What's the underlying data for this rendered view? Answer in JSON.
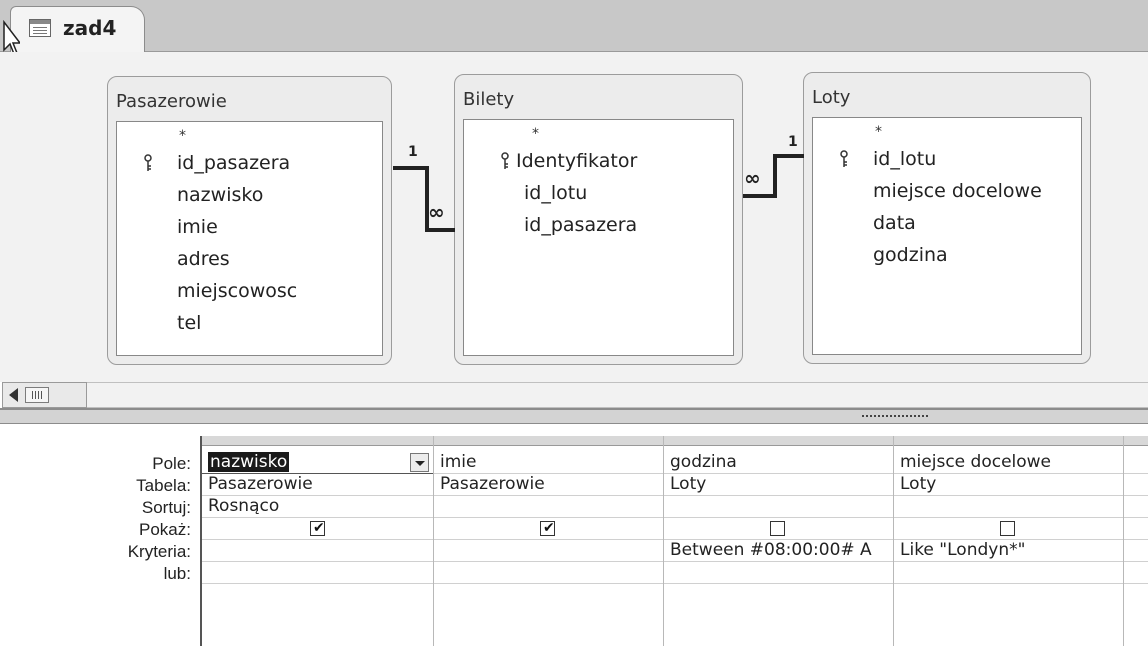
{
  "tab": {
    "title": "zad4"
  },
  "tables": [
    {
      "name": "Pasazerowie",
      "fields": [
        "*",
        "id_pasazera",
        "nazwisko",
        "imie",
        "adres",
        "miejscowosc",
        "tel"
      ]
    },
    {
      "name": "Bilety",
      "fields": [
        "*",
        "Identyfikator",
        "id_lotu",
        "id_pasazera"
      ]
    },
    {
      "name": "Loty",
      "fields": [
        "*",
        "id_lotu",
        "miejsce docelowe",
        "data",
        "godzina"
      ]
    }
  ],
  "relations": [
    {
      "one": "1",
      "many": "∞"
    },
    {
      "one": "1",
      "many": "∞"
    }
  ],
  "grid": {
    "row_labels": [
      "Pole:",
      "Tabela:",
      "Sortuj:",
      "Pokaż:",
      "Kryteria:",
      "lub:"
    ],
    "columns": [
      {
        "field": "nazwisko",
        "table": "Pasazerowie",
        "sort": "Rosnąco",
        "show": true,
        "criteria": "",
        "or": ""
      },
      {
        "field": "imie",
        "table": "Pasazerowie",
        "sort": "",
        "show": true,
        "criteria": "",
        "or": ""
      },
      {
        "field": "godzina",
        "table": "Loty",
        "sort": "",
        "show": false,
        "criteria": "Between #08:00:00# A",
        "or": ""
      },
      {
        "field": "miejsce docelowe",
        "table": "Loty",
        "sort": "",
        "show": false,
        "criteria": "Like \"Londyn*\"",
        "or": ""
      }
    ]
  },
  "icons": {
    "tab": "query-icon",
    "key": "primary-key-icon",
    "scroll_left": "scroll-left-arrow-icon",
    "dropdown": "dropdown-arrow-icon",
    "checkbox": "checkbox-icon"
  },
  "colors": {
    "selection": "#1a1a1a",
    "pane": "#f2f2f2",
    "tabbar": "#c8c8c8"
  }
}
